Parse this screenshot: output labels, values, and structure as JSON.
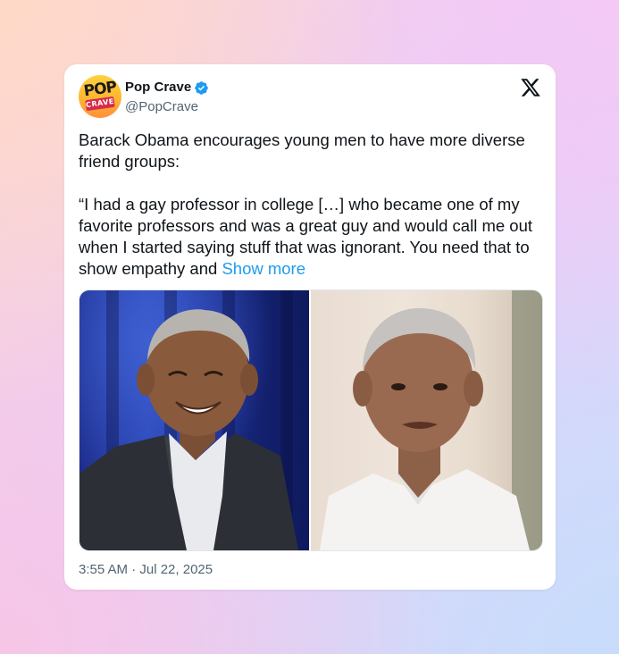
{
  "author": {
    "display_name": "Pop Crave",
    "handle": "@PopCrave",
    "avatar_text_top": "POP",
    "avatar_text_bottom": "CRAVE",
    "verified": true,
    "verified_color": "#1d9bf0"
  },
  "platform_icon": "x-logo-icon",
  "tweet": {
    "line_intro": "Barack Obama encourages young men to have more diverse friend groups:",
    "quote": "“I had a gay professor in college […] who became one of my favorite professors and was a great guy and would call me out when I started saying stuff that was ignorant. You need that to show empathy and",
    "show_more_label": "Show more"
  },
  "media": [
    {
      "description": "barack-obama-smiling-blue-curtain-photo"
    },
    {
      "description": "barack-obama-speaking-white-shirt-photo"
    }
  ],
  "timestamp": "3:55 AM · Jul 22, 2025",
  "colors": {
    "link": "#1d9bf0",
    "text": "#0f1419",
    "secondary": "#536471"
  }
}
